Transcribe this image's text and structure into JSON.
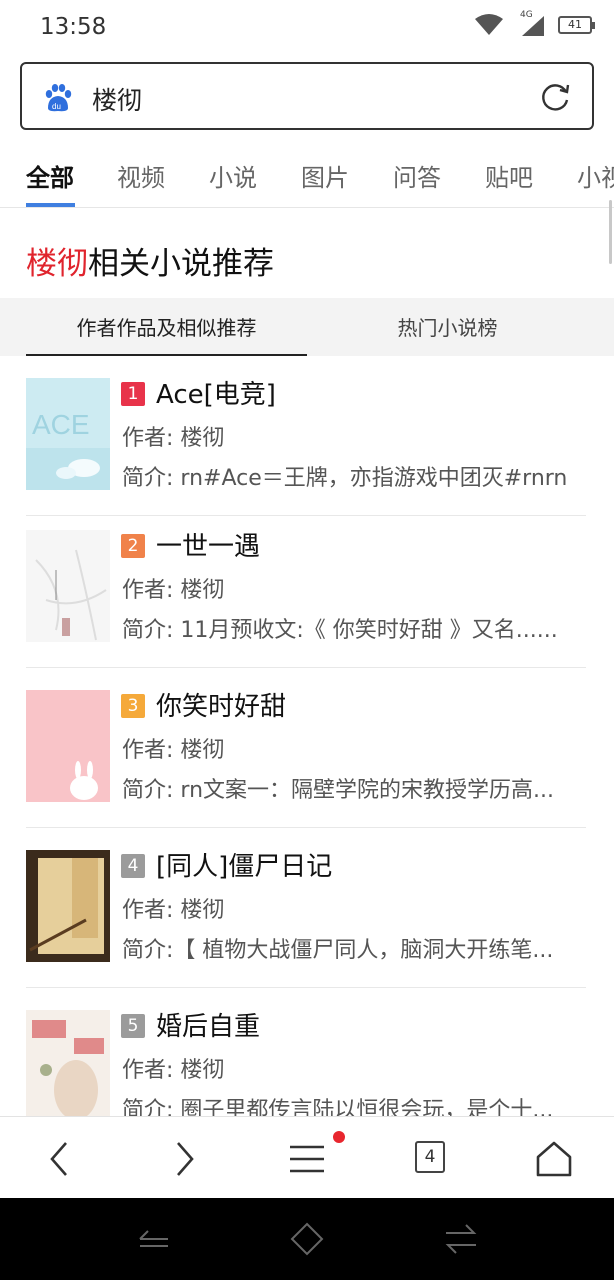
{
  "status_bar": {
    "time": "13:58",
    "network": "4G",
    "battery": "41"
  },
  "search": {
    "query": "楼彻",
    "logo": "baidu-paw-icon",
    "action_icon": "refresh-icon"
  },
  "tabs": [
    "全部",
    "视频",
    "小说",
    "图片",
    "问答",
    "贴吧",
    "小视"
  ],
  "section": {
    "keyword": "楼彻",
    "title_rest": "相关小说推荐"
  },
  "subtabs": [
    "作者作品及相似推荐",
    "热门小说榜"
  ],
  "books": [
    {
      "rank": "1",
      "title": "Ace[电竞]",
      "author": "作者: 楼彻",
      "intro": "简介: rn#Ace＝王牌，亦指游戏中团灭#rnrn",
      "rank_color": "#e8334a"
    },
    {
      "rank": "2",
      "title": "一世一遇",
      "author": "作者: 楼彻",
      "intro": "简介: 11月预收文:《 你笑时好甜 》又名......",
      "rank_color": "#f0824a"
    },
    {
      "rank": "3",
      "title": "你笑时好甜",
      "author": "作者: 楼彻",
      "intro": "简介: rn文案一：隔壁学院的宋教授学历高...",
      "rank_color": "#f5a93a"
    },
    {
      "rank": "4",
      "title": "[同人]僵尸日记",
      "author": "作者: 楼彻",
      "intro": "简介:【 植物大战僵尸同人，脑洞大开练笔...",
      "rank_color": "#9b9b9b"
    },
    {
      "rank": "5",
      "title": "婚后自重",
      "author": "作者: 楼彻",
      "intro": "简介: 圈子里都传言陆以恒很会玩，是个十...",
      "rank_color": "#9b9b9b"
    }
  ],
  "toolbar": {
    "tab_count": "4"
  },
  "colors": {
    "accent": "#3f7fe0",
    "keyword_red": "#e0242d"
  }
}
